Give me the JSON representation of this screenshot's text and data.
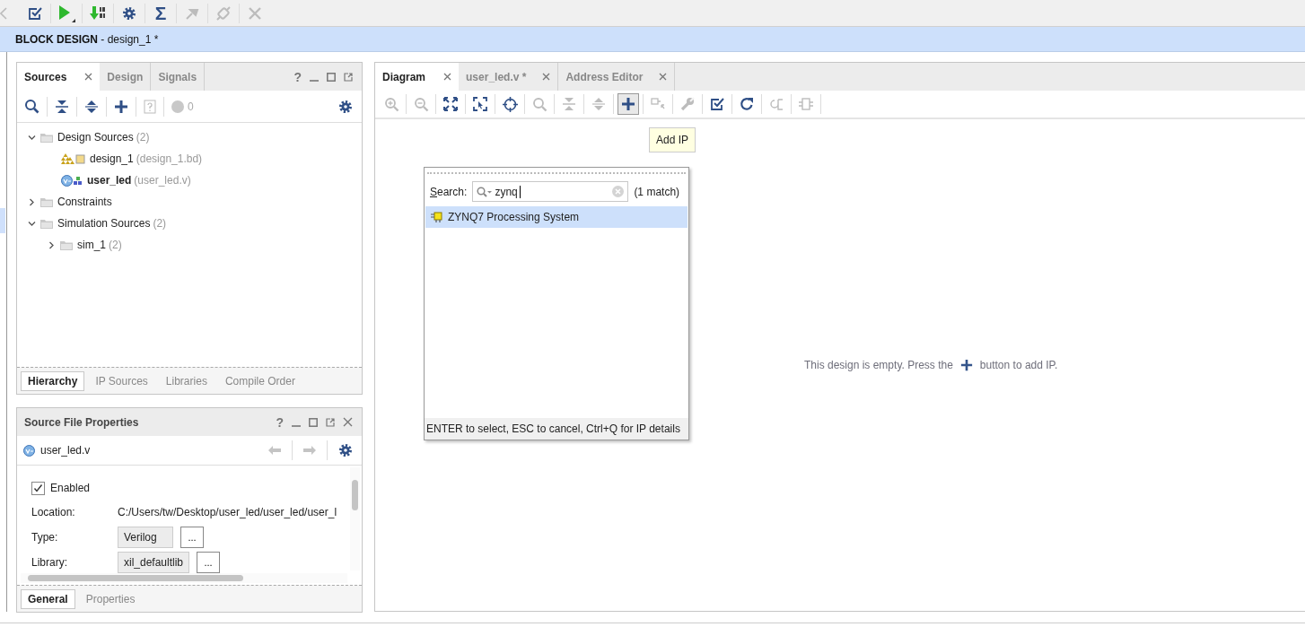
{
  "toolbar": [
    {
      "kind": "back",
      "disabled": true
    },
    {
      "kind": "validate",
      "disabled": false
    },
    {
      "kind": "run",
      "disabled": false
    },
    {
      "kind": "program",
      "disabled": false
    },
    {
      "kind": "settings",
      "disabled": false
    },
    {
      "kind": "sum",
      "label": "Σ",
      "disabled": false
    },
    {
      "kind": "pin",
      "disabled": true
    },
    {
      "kind": "probe",
      "disabled": true
    },
    {
      "kind": "cross",
      "disabled": true
    }
  ],
  "header": {
    "title": "**BLOCK DESIGN** - design_1 *"
  },
  "sources_panel": {
    "help": "?",
    "tabs": [
      {
        "label": "Sources",
        "selected": true
      },
      {
        "label": "Design",
        "selected": false
      },
      {
        "label": "Signals",
        "selected": false
      }
    ],
    "issue_count": "0",
    "tree": [
      {
        "label": "Design Sources",
        "count": "(2)",
        "kind": "folder",
        "expanded": true,
        "children": [
          {
            "label": "design_1",
            "detail": "(design_1.bd)",
            "kind": "block",
            "top": false
          },
          {
            "label": "user_led",
            "detail": "(user_led.v)",
            "kind": "verilog",
            "top": true
          }
        ]
      },
      {
        "label": "Constraints",
        "kind": "folder",
        "expanded": false
      },
      {
        "label": "Simulation Sources",
        "count": "(2)",
        "kind": "folder",
        "expanded": true,
        "children": [
          {
            "label": "sim_1",
            "count": "(2)",
            "kind": "folder",
            "expanded": false
          }
        ]
      }
    ],
    "bottom_tabs": [
      {
        "label": "Hierarchy",
        "selected": true
      },
      {
        "label": "IP Sources",
        "selected": false
      },
      {
        "label": "Libraries",
        "selected": false
      },
      {
        "label": "Compile Order",
        "selected": false
      }
    ]
  },
  "properties_panel": {
    "title": "Source File Properties",
    "help": "?",
    "file": "user_led.v",
    "enabled": {
      "label": "Enabled",
      "checked": true
    },
    "fields": [
      {
        "label": "Location:",
        "value": "C:/Users/tw/Desktop/user_led/user_led/user_l",
        "kind": "text"
      },
      {
        "label": "Type:",
        "value": "Verilog",
        "kind": "select",
        "button": "..."
      },
      {
        "label": "Library:",
        "value": "xil_defaultlib",
        "kind": "select",
        "button": "..."
      }
    ],
    "tabs": [
      {
        "label": "General",
        "selected": true
      },
      {
        "label": "Properties",
        "selected": false
      }
    ]
  },
  "diagram_panel": {
    "tabs": [
      {
        "label": "Diagram",
        "selected": true
      },
      {
        "label": "user_led.v *",
        "selected": false
      },
      {
        "label": "Address Editor",
        "selected": false
      }
    ],
    "toolbar": [
      {
        "kind": "zoom-in",
        "disabled": true,
        "pressed": false
      },
      {
        "kind": "zoom-out",
        "disabled": true,
        "pressed": false
      },
      {
        "kind": "fit",
        "disabled": false,
        "pressed": false
      },
      {
        "kind": "select-area",
        "disabled": false,
        "pressed": false
      },
      {
        "kind": "center",
        "disabled": false,
        "pressed": false
      },
      {
        "kind": "search",
        "disabled": true,
        "pressed": false
      },
      {
        "kind": "collapse",
        "disabled": true,
        "pressed": false
      },
      {
        "kind": "expand",
        "disabled": true,
        "pressed": false
      },
      {
        "kind": "add",
        "disabled": false,
        "pressed": true
      },
      {
        "kind": "connect",
        "disabled": true,
        "pressed": false
      },
      {
        "kind": "tool",
        "disabled": true,
        "pressed": false
      },
      {
        "kind": "validate",
        "disabled": false,
        "pressed": false
      },
      {
        "kind": "refresh",
        "disabled": false,
        "pressed": false
      },
      {
        "kind": "regenerate",
        "disabled": true,
        "pressed": false
      },
      {
        "kind": "port",
        "disabled": true,
        "pressed": false
      }
    ],
    "tooltip": "Add IP",
    "popup": {
      "search_label": "Search:",
      "query": "zynq",
      "match_count": "(1 match)",
      "results": [
        {
          "label": "ZYNQ7 Processing System",
          "selected": true
        }
      ],
      "footer": "ENTER to select, ESC to cancel, Ctrl+Q for IP details"
    },
    "empty_message": {
      "before": "This design is empty. Press the",
      "after": "button to add IP."
    }
  }
}
